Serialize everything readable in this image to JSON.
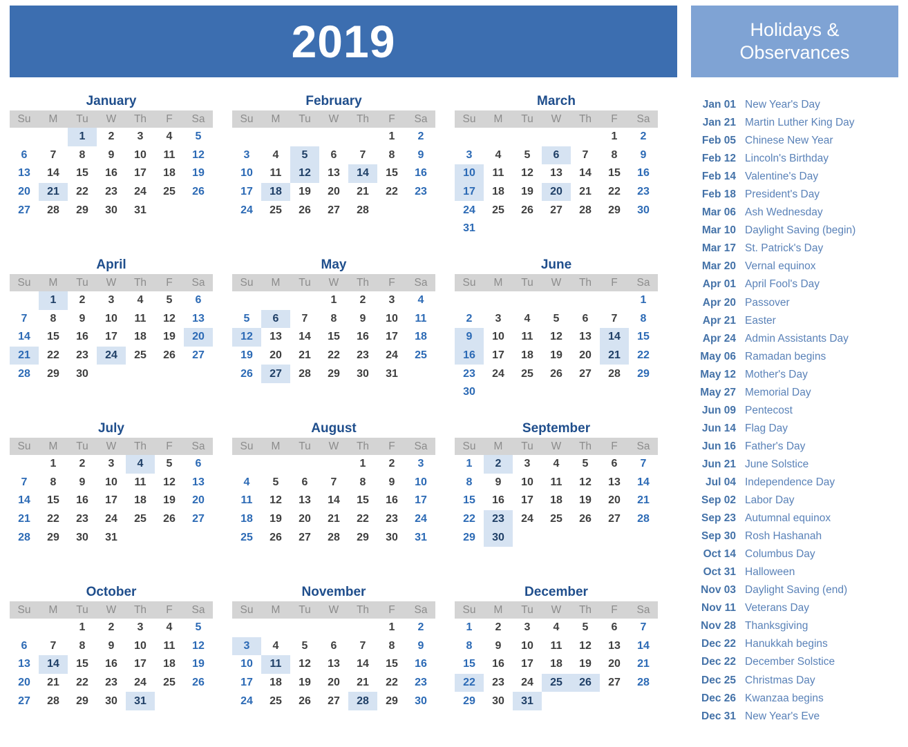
{
  "year_banner": {
    "year": "2019",
    "bg_color": "#3C6EB0"
  },
  "holidays_panel": {
    "title_line1": "Holidays &",
    "title_line2": "Observances",
    "header_bg_color": "#7FA3D4",
    "date_color": "#4472A8",
    "name_color": "#5A82B8",
    "items": [
      {
        "date": "Jan 01",
        "name": "New Year's Day"
      },
      {
        "date": "Jan 21",
        "name": "Martin Luther King Day"
      },
      {
        "date": "Feb 05",
        "name": "Chinese New Year"
      },
      {
        "date": "Feb 12",
        "name": "Lincoln's Birthday"
      },
      {
        "date": "Feb 14",
        "name": "Valentine's Day"
      },
      {
        "date": "Feb 18",
        "name": "President's Day"
      },
      {
        "date": "Mar 06",
        "name": "Ash Wednesday"
      },
      {
        "date": "Mar 10",
        "name": "Daylight Saving (begin)"
      },
      {
        "date": "Mar 17",
        "name": "St. Patrick's Day"
      },
      {
        "date": "Mar 20",
        "name": "Vernal equinox"
      },
      {
        "date": "Apr 01",
        "name": "April Fool's Day"
      },
      {
        "date": "Apr 20",
        "name": "Passover"
      },
      {
        "date": "Apr 21",
        "name": "Easter"
      },
      {
        "date": "Apr 24",
        "name": "Admin Assistants Day"
      },
      {
        "date": "May 06",
        "name": "Ramadan begins"
      },
      {
        "date": "May 12",
        "name": "Mother's Day"
      },
      {
        "date": "May 27",
        "name": "Memorial Day"
      },
      {
        "date": "Jun 09",
        "name": "Pentecost"
      },
      {
        "date": "Jun 14",
        "name": "Flag Day"
      },
      {
        "date": "Jun 16",
        "name": "Father's Day"
      },
      {
        "date": "Jun 21",
        "name": "June Solstice"
      },
      {
        "date": "Jul 04",
        "name": "Independence Day"
      },
      {
        "date": "Sep 02",
        "name": "Labor Day"
      },
      {
        "date": "Sep 23",
        "name": "Autumnal equinox"
      },
      {
        "date": "Sep 30",
        "name": "Rosh Hashanah"
      },
      {
        "date": "Oct 14",
        "name": "Columbus Day"
      },
      {
        "date": "Oct 31",
        "name": "Halloween"
      },
      {
        "date": "Nov 03",
        "name": "Daylight Saving (end)"
      },
      {
        "date": "Nov 11",
        "name": "Veterans Day"
      },
      {
        "date": "Nov 28",
        "name": "Thanksgiving"
      },
      {
        "date": "Dec 22",
        "name": "Hanukkah begins"
      },
      {
        "date": "Dec 22",
        "name": "December Solstice"
      },
      {
        "date": "Dec 25",
        "name": "Christmas Day"
      },
      {
        "date": "Dec 26",
        "name": "Kwanzaa begins"
      },
      {
        "date": "Dec 31",
        "name": "New Year's Eve"
      }
    ]
  },
  "calendar": {
    "weekday_headers": [
      "Su",
      "M",
      "Tu",
      "W",
      "Th",
      "F",
      "Sa"
    ],
    "weekend_color": "#2C6AB5",
    "weekday_color": "#3F3F3F",
    "header_bg_color": "#D4D4D4",
    "header_text_color": "#8C8C8C",
    "highlight_bg_color": "#D6E3F2",
    "months": [
      {
        "name": "January",
        "days": 31,
        "first_weekday": 2,
        "highlights": [
          1,
          21
        ]
      },
      {
        "name": "February",
        "days": 28,
        "first_weekday": 5,
        "highlights": [
          5,
          12,
          14,
          18
        ]
      },
      {
        "name": "March",
        "days": 31,
        "first_weekday": 5,
        "highlights": [
          6,
          10,
          17,
          20
        ]
      },
      {
        "name": "April",
        "days": 30,
        "first_weekday": 1,
        "highlights": [
          1,
          20,
          21,
          24
        ]
      },
      {
        "name": "May",
        "days": 31,
        "first_weekday": 3,
        "highlights": [
          6,
          12,
          27
        ]
      },
      {
        "name": "June",
        "days": 30,
        "first_weekday": 6,
        "highlights": [
          9,
          14,
          16,
          21
        ]
      },
      {
        "name": "July",
        "days": 31,
        "first_weekday": 1,
        "highlights": [
          4
        ]
      },
      {
        "name": "August",
        "days": 31,
        "first_weekday": 4,
        "highlights": []
      },
      {
        "name": "September",
        "days": 30,
        "first_weekday": 0,
        "highlights": [
          2,
          23,
          30
        ]
      },
      {
        "name": "October",
        "days": 31,
        "first_weekday": 2,
        "highlights": [
          14,
          31
        ]
      },
      {
        "name": "November",
        "days": 30,
        "first_weekday": 5,
        "highlights": [
          3,
          11,
          28
        ]
      },
      {
        "name": "December",
        "days": 31,
        "first_weekday": 0,
        "highlights": [
          22,
          25,
          26,
          31
        ]
      }
    ]
  }
}
